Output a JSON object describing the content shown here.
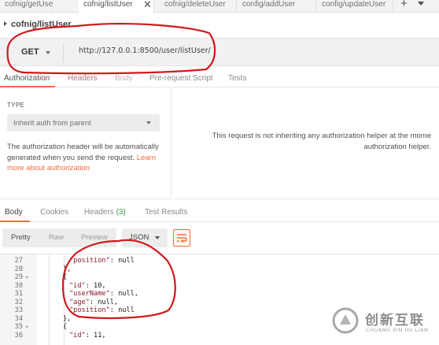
{
  "tabs": [
    {
      "label": "cofnig/getUser",
      "active": false
    },
    {
      "label": "cofnig/listUser",
      "active": true
    },
    {
      "label": "cofnig/deleteUser",
      "active": false
    },
    {
      "label": "config/addUser",
      "active": false
    },
    {
      "label": "config/updateUser",
      "active": false
    }
  ],
  "tab_actions": {
    "close": "✕",
    "new_tab": "+"
  },
  "request": {
    "title": "cofnig/listUser",
    "method": "GET",
    "url": "http://127.0.0.1:8500/user/listUser/"
  },
  "request_tabs": [
    {
      "label": "Authorization",
      "state": "active"
    },
    {
      "label": "Headers",
      "state": "normal"
    },
    {
      "label": "Body",
      "state": "disabled"
    },
    {
      "label": "Pre-request Script",
      "state": "normal"
    },
    {
      "label": "Tests",
      "state": "normal"
    }
  ],
  "auth": {
    "type_label": "TYPE",
    "type_value": "Inherit auth from parent",
    "description": "The authorization header will be automatically generated when you send the request.",
    "learn_more": "Learn more about authorization",
    "message_line1": "This request is not inheriting any authorization helper at the mome",
    "message_line2": "authorization helper."
  },
  "response_tabs": [
    {
      "label": "Body",
      "count": "",
      "active": true
    },
    {
      "label": "Cookies",
      "count": "",
      "active": false
    },
    {
      "label": "Headers",
      "count": "(3)",
      "active": false
    },
    {
      "label": "Test Results",
      "count": "",
      "active": false
    }
  ],
  "format": {
    "modes": [
      {
        "label": "Pretty",
        "active": true
      },
      {
        "label": "Raw",
        "active": false
      },
      {
        "label": "Preview",
        "active": false
      }
    ],
    "language": "JSON",
    "wrap_icon": "wrap-lines-icon"
  },
  "code_lines": [
    {
      "n": "27",
      "fold": "",
      "indent": 2,
      "key": "\"position\"",
      "rest": ": null"
    },
    {
      "n": "28",
      "fold": "",
      "indent": 1,
      "key": "",
      "rest": "},"
    },
    {
      "n": "29",
      "fold": "▾",
      "indent": 1,
      "key": "",
      "rest": "{"
    },
    {
      "n": "30",
      "fold": "",
      "indent": 2,
      "key": "\"id\"",
      "rest": ": 10,"
    },
    {
      "n": "31",
      "fold": "",
      "indent": 2,
      "key": "\"userName\"",
      "rest": ": null,"
    },
    {
      "n": "32",
      "fold": "",
      "indent": 2,
      "key": "\"age\"",
      "rest": ": null,"
    },
    {
      "n": "33",
      "fold": "",
      "indent": 2,
      "key": "\"position\"",
      "rest": ": null"
    },
    {
      "n": "34",
      "fold": "",
      "indent": 1,
      "key": "",
      "rest": "},"
    },
    {
      "n": "35",
      "fold": "▾",
      "indent": 1,
      "key": "",
      "rest": "{"
    },
    {
      "n": "36",
      "fold": "",
      "indent": 2,
      "key": "\"id\"",
      "rest": ": 11,"
    }
  ],
  "watermark": {
    "title": "创新互联",
    "subtitle": "CHUANG XIN HU LIAN"
  },
  "colors": {
    "accent": "#f26b3a",
    "annotation": "#d0181b",
    "count": "#3a9b44"
  }
}
